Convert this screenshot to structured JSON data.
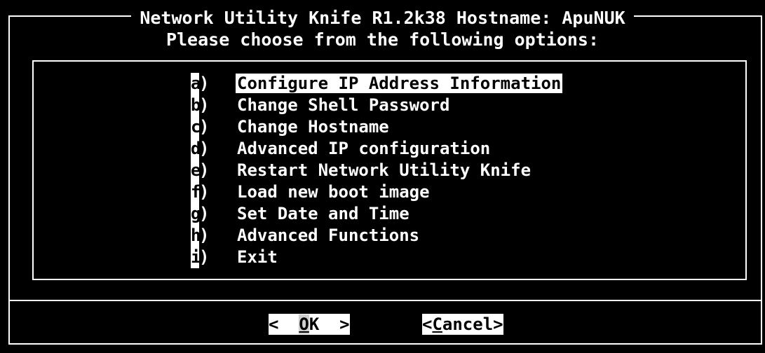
{
  "dialog": {
    "title": "Network Utility Knife R1.2k38 Hostname: ApuNUK",
    "subtitle": "Please choose from the following options:"
  },
  "menu": {
    "items": [
      {
        "key": "a",
        "label": "Configure IP Address Information",
        "selected": true
      },
      {
        "key": "b",
        "label": "Change Shell Password",
        "selected": false
      },
      {
        "key": "c",
        "label": "Change Hostname",
        "selected": false
      },
      {
        "key": "d",
        "label": "Advanced IP configuration",
        "selected": false
      },
      {
        "key": "e",
        "label": "Restart Network Utility Knife",
        "selected": false
      },
      {
        "key": "f",
        "label": "Load new boot image",
        "selected": false
      },
      {
        "key": "g",
        "label": "Set Date and Time",
        "selected": false
      },
      {
        "key": "h",
        "label": "Advanced Functions",
        "selected": false
      },
      {
        "key": "i",
        "label": "Exit",
        "selected": false
      }
    ],
    "key_suffix": ")"
  },
  "buttons": {
    "ok": {
      "prefix": "<  ",
      "hotkey": "O",
      "rest": "K  >"
    },
    "cancel": {
      "prefix": "<",
      "hotkey": "C",
      "rest": "ancel>"
    }
  },
  "colors": {
    "background": "#000000",
    "foreground": "#ffffff",
    "highlight_bg": "#ffffff",
    "highlight_fg": "#000000"
  }
}
